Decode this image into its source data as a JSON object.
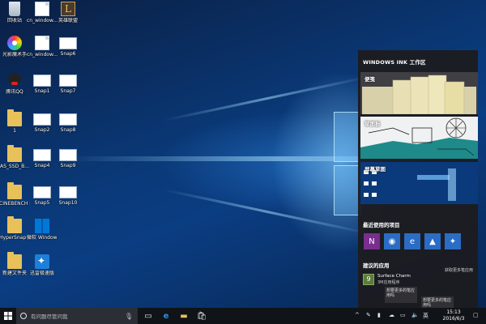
{
  "desktop": {
    "icons": [
      {
        "label": "回收站",
        "icon": "recycle-bin-icon"
      },
      {
        "label": "cn_window...",
        "icon": "file-icon"
      },
      {
        "label": "英雄联盟",
        "icon": "league-game-icon"
      },
      {
        "label": "光影魔术手",
        "icon": "nEO-imaging-icon"
      },
      {
        "label": "cn_window...",
        "icon": "file-icon"
      },
      {
        "label": "Snap6",
        "icon": "screenshot-icon"
      },
      {
        "label": "腾讯QQ",
        "icon": "qq-icon"
      },
      {
        "label": "Snap1",
        "icon": "screenshot-icon"
      },
      {
        "label": "Snap7",
        "icon": "screenshot-icon"
      },
      {
        "label": "1",
        "icon": "folder-icon"
      },
      {
        "label": "Snap2",
        "icon": "screenshot-icon"
      },
      {
        "label": "Snap8",
        "icon": "screenshot-icon"
      },
      {
        "label": "AS_SSD_B...",
        "icon": "folder-icon"
      },
      {
        "label": "Snap4",
        "icon": "screenshot-icon"
      },
      {
        "label": "Snap9",
        "icon": "screenshot-icon"
      },
      {
        "label": "CINEBENCH R15",
        "icon": "folder-icon"
      },
      {
        "label": "Snap5",
        "icon": "screenshot-icon"
      },
      {
        "label": "Snap10",
        "icon": "screenshot-icon"
      },
      {
        "label": "HyperSnap 6",
        "icon": "folder-icon"
      },
      {
        "label": "微软 Windows ...",
        "icon": "windows-icon"
      },
      {
        "label": "新建文件夹",
        "icon": "folder-icon"
      },
      {
        "label": "迅雷极速版",
        "icon": "xunlei-icon"
      }
    ]
  },
  "ink": {
    "title": "WINDOWS INK 工作区",
    "cards": [
      {
        "label": "便笺"
      },
      {
        "label": "草图板"
      },
      {
        "label": "屏幕草图"
      }
    ],
    "recent_title": "最近使用的项目",
    "recent_items": [
      {
        "icon": "onenote-icon",
        "glyph": "N"
      },
      {
        "icon": "maps-icon",
        "glyph": "◉"
      },
      {
        "icon": "edge-icon",
        "glyph": "e"
      },
      {
        "icon": "photos-icon",
        "glyph": "▲"
      },
      {
        "icon": "tips-icon",
        "glyph": "✦"
      }
    ],
    "suggested_title": "建议的应用",
    "suggested_app": {
      "tile": "9",
      "name": "Surface Charm",
      "sub": "3M应用程序",
      "action": "获取更多笔应用"
    }
  },
  "toasts": [
    {
      "text": "想要更多的笔应用吗"
    },
    {
      "text": "想要更多的笔应用吗"
    }
  ],
  "taskbar": {
    "search_placeholder": "有问题尽管问我",
    "input_method": "英",
    "time": "15:13",
    "date": "2016/6/3"
  }
}
